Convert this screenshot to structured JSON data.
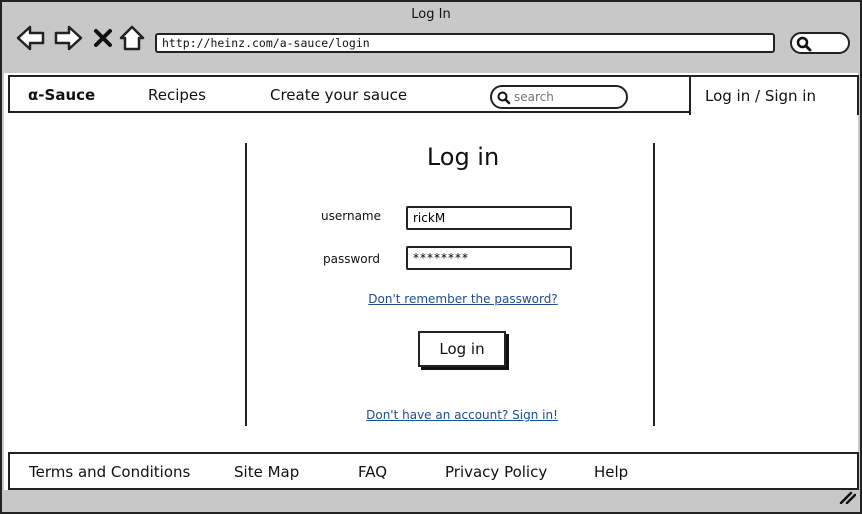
{
  "window": {
    "title": "Log In",
    "url": "http://heinz.com/a-sauce/login"
  },
  "icons": {
    "back": "arrow-left-icon",
    "forward": "arrow-right-icon",
    "stop": "close-icon",
    "home": "home-icon",
    "search": "search-icon",
    "resize": "resize-grip-icon"
  },
  "nav": {
    "brand": "α-Sauce",
    "items": [
      "Recipes",
      "Create your sauce"
    ],
    "search_placeholder": "search",
    "signin": "Log in / Sign in"
  },
  "login": {
    "heading": "Log in",
    "username_label": "username",
    "username_value": "rickM",
    "password_label": "password",
    "password_value": "********",
    "forgot_link": "Don't remember the password?",
    "button": "Log in",
    "signup_link": "Don't have an account? Sign in!"
  },
  "footer": {
    "items": [
      "Terms and Conditions",
      "Site Map",
      "FAQ",
      "Privacy Policy",
      "Help"
    ]
  },
  "colors": {
    "chrome": "#c8c8c8",
    "link": "#1b4f8f",
    "border": "#222222"
  }
}
